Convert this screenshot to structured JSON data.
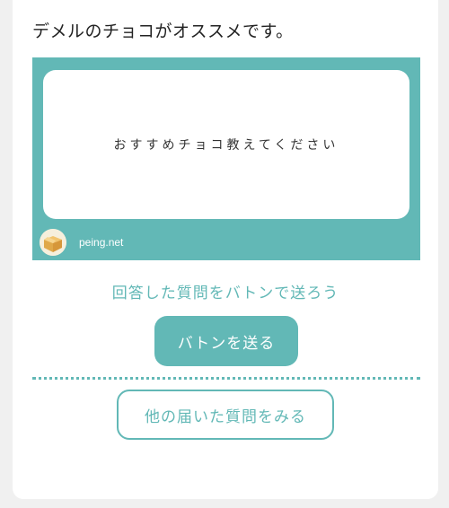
{
  "answer": {
    "text": "デメルのチョコがオススメです。"
  },
  "question_card": {
    "question": "おすすめチョコ教えてください",
    "source": "peing.net",
    "frame_color": "#62b8b6"
  },
  "actions": {
    "hint": "回答した質問をバトンで送ろう",
    "send_label": "バトンを送る",
    "more_label": "他の届いた質問をみる"
  },
  "icons": {
    "avatar": "cardboard-box-icon"
  },
  "colors": {
    "accent": "#62b8b6",
    "background": "#f0f0f0",
    "card": "#ffffff"
  }
}
